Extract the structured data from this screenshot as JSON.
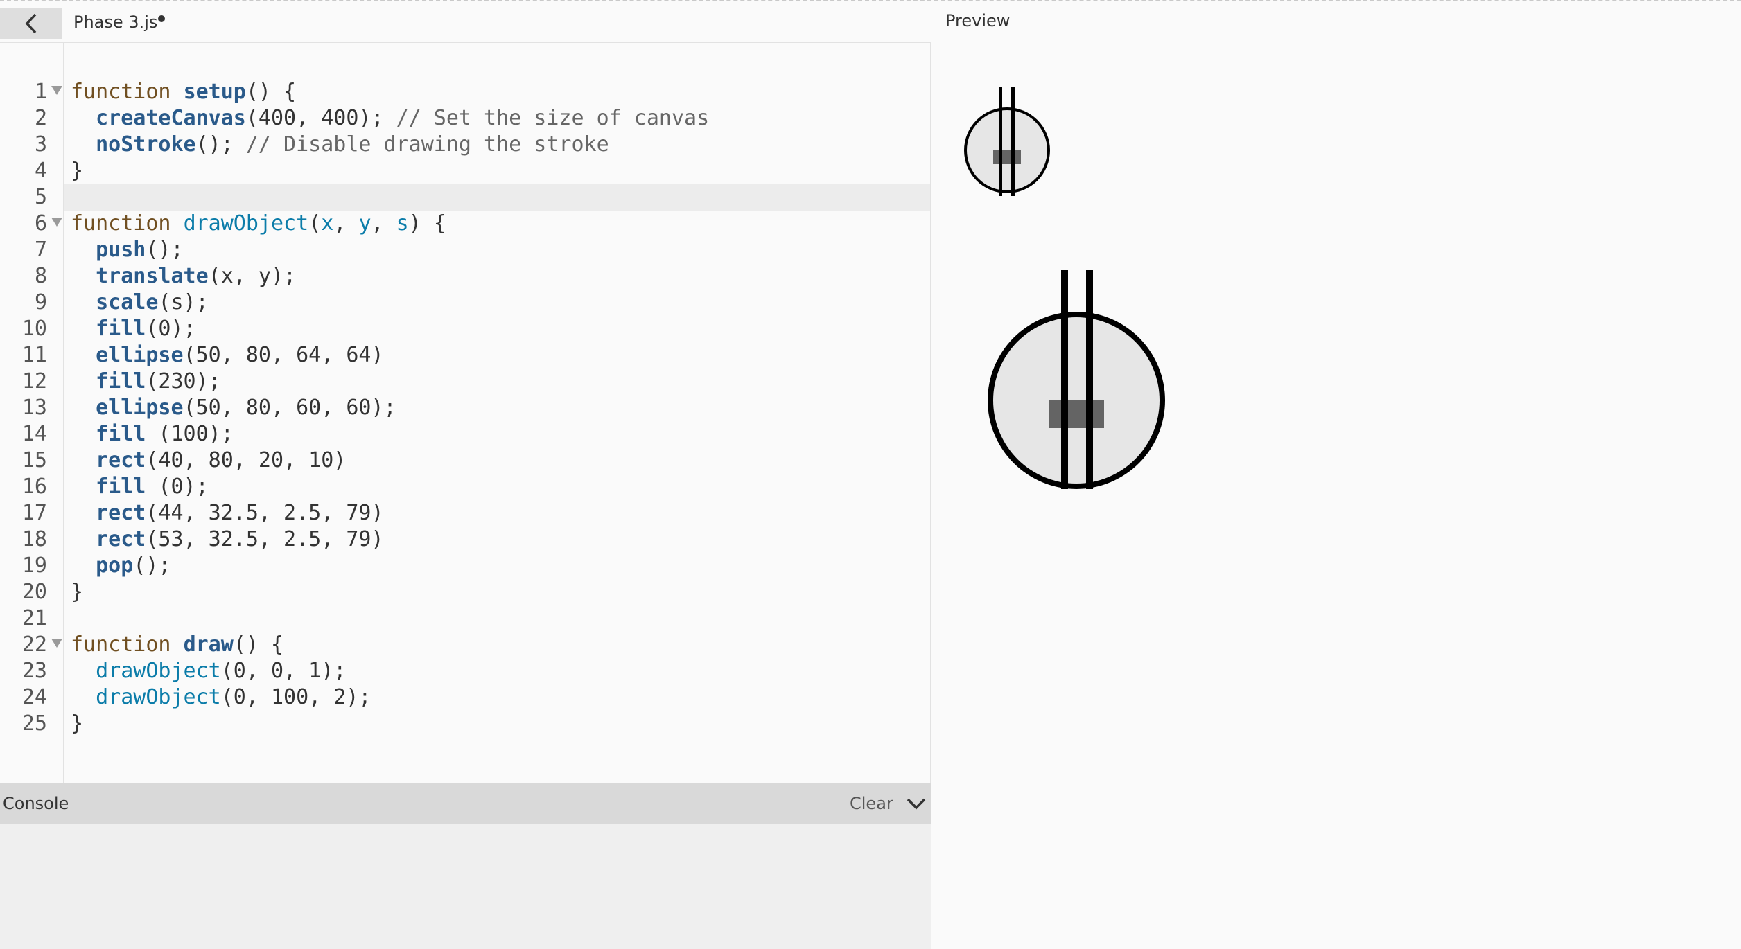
{
  "header": {
    "back_icon": "chevron-left-icon",
    "file_name": "Phase 3.js",
    "preview_label": "Preview"
  },
  "editor": {
    "line_numbers": [
      "1",
      "2",
      "3",
      "4",
      "5",
      "6",
      "7",
      "8",
      "9",
      "10",
      "11",
      "12",
      "13",
      "14",
      "15",
      "16",
      "17",
      "18",
      "19",
      "20",
      "21",
      "22",
      "23",
      "24",
      "25"
    ],
    "foldable_lines": [
      1,
      6,
      22
    ],
    "active_line": 5
  },
  "console": {
    "label": "Console",
    "clear_label": "Clear",
    "collapse_icon": "chevron-down-icon"
  },
  "colors": {
    "keyword": "#704f21",
    "function_name": "#0b7ca9",
    "builtin": "#2a5a8a",
    "comment": "#666666"
  }
}
